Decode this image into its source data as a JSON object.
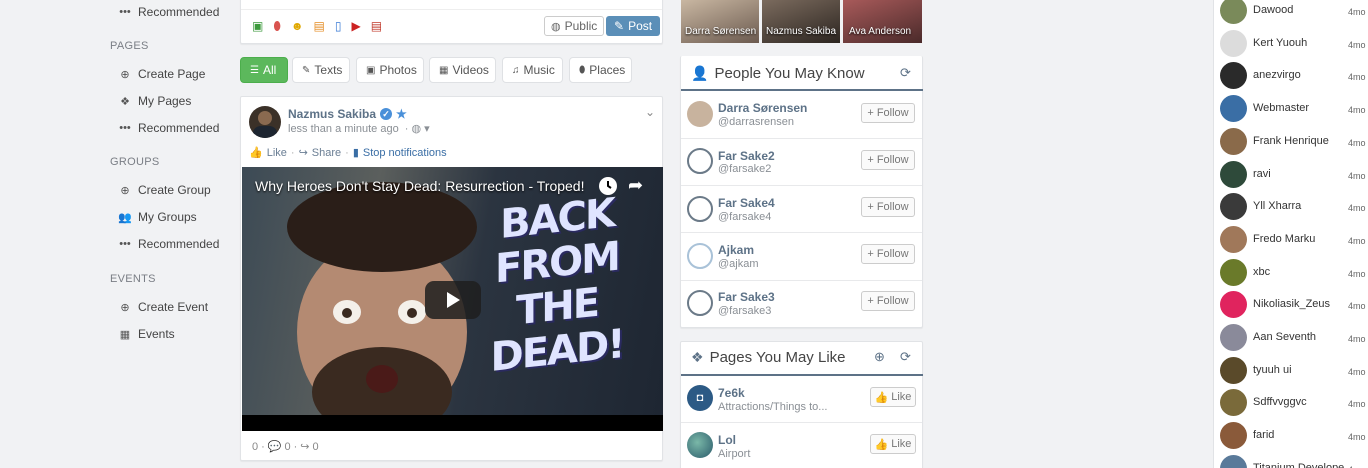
{
  "sidebar": {
    "top_item": "Recommended",
    "pages_title": "PAGES",
    "pages_items": [
      "Create Page",
      "My Pages",
      "Recommended"
    ],
    "groups_title": "GROUPS",
    "groups_items": [
      "Create Group",
      "My Groups",
      "Recommended"
    ],
    "events_title": "EVENTS",
    "events_items": [
      "Create Event",
      "Events"
    ]
  },
  "composer": {
    "privacy_label": "Public",
    "post_label": "Post"
  },
  "filters": [
    "All",
    "Texts",
    "Photos",
    "Videos",
    "Music",
    "Places"
  ],
  "post": {
    "author": "Nazmus Sakiba",
    "time": "less than a minute ago",
    "actions": {
      "like": "Like",
      "share": "Share",
      "stop": "Stop notifications"
    },
    "video": {
      "title": "Why Heroes Don't Stay Dead: Resurrection - Troped!",
      "overlay_line1": "BACK FROM",
      "overlay_line2": "THE DEAD!"
    },
    "stats": {
      "likes": "0",
      "comments": "0",
      "shares": "0"
    }
  },
  "photo_strip": [
    "Darra Sørensen",
    "Nazmus Sakiba",
    "Ava Anderson"
  ],
  "people_panel": {
    "title": "People You May Know",
    "follow_label": "Follow",
    "people": [
      {
        "name": "Darra Sørensen",
        "handle": "@darrasrensen"
      },
      {
        "name": "Far Sake2",
        "handle": "@farsake2"
      },
      {
        "name": "Far Sake4",
        "handle": "@farsake4"
      },
      {
        "name": "Ajkam",
        "handle": "@ajkam"
      },
      {
        "name": "Far Sake3",
        "handle": "@farsake3"
      }
    ]
  },
  "pages_panel": {
    "title": "Pages You May Like",
    "like_label": "Like",
    "pages": [
      {
        "name": "7e6k",
        "category": "Attractions/Things to..."
      },
      {
        "name": "Lol",
        "category": "Airport"
      }
    ]
  },
  "chat": {
    "time_label": "4mo",
    "users": [
      "Dawood",
      "Kert Yuouh",
      "anezvirgo",
      "Webmaster",
      "Frank Henrique",
      "ravi",
      "Yll Xharra",
      "Fredo Marku",
      "xbc",
      "Nikoliasik_Zeus",
      "Aan Seventh",
      "tyuuh ui",
      "Sdffvvggvc",
      "farid",
      "Titanium Develope"
    ],
    "colors": [
      "#7a8a5a",
      "#dcdcdc",
      "#2a2a2a",
      "#3a6ea5",
      "#8a6a4a",
      "#2e4a3a",
      "#3a3a3a",
      "#a0785a",
      "#6a7a2a",
      "#e0245e",
      "#8a8a9a",
      "#5a4a2a",
      "#7a6a3a",
      "#8a5a3a",
      "#5a7a9a"
    ]
  }
}
